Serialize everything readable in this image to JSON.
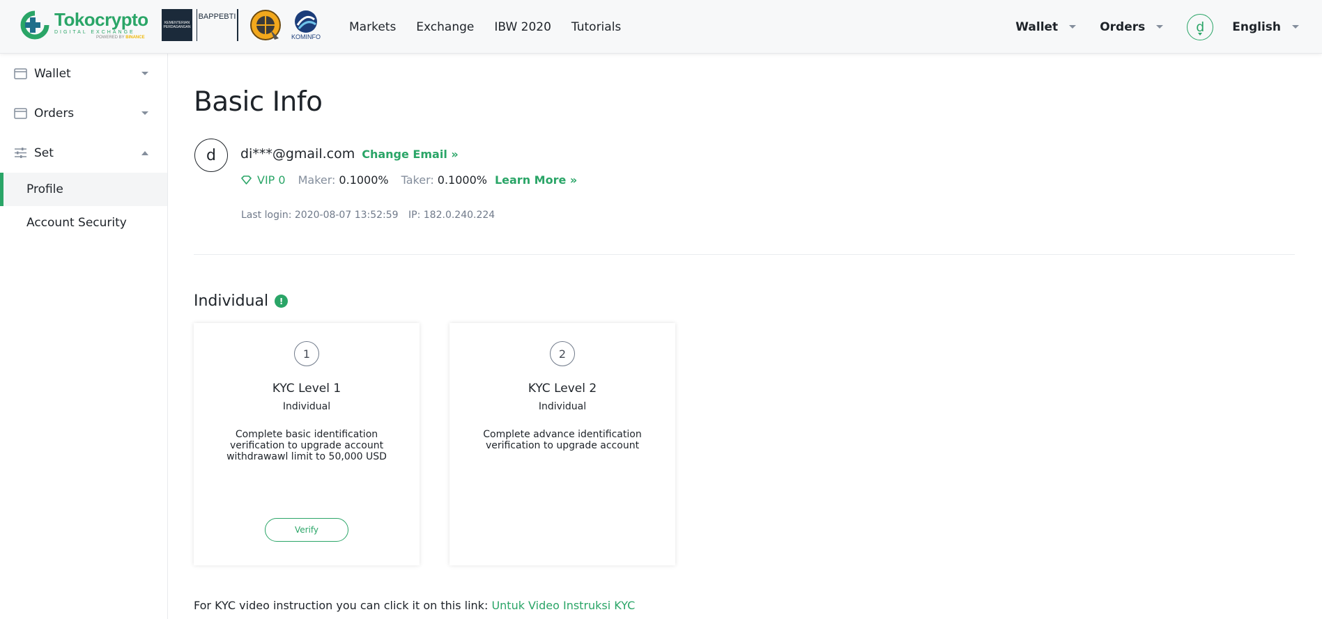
{
  "header": {
    "logo": {
      "title": "Tokocrypto",
      "subtitle": "DIGITAL EXCHANGE",
      "powered_by": "POWERED BY",
      "powered_brand": "BINANCE"
    },
    "partners": {
      "bappebti": "BAPPEBTI",
      "kemendag": "KEMENTERIAN PERDAGANGAN",
      "kominfo": "KOMINFO"
    },
    "nav": [
      "Markets",
      "Exchange",
      "IBW 2020",
      "Tutorials"
    ],
    "right": {
      "wallet": "Wallet",
      "orders": "Orders",
      "avatar_initial": "d",
      "language": "English"
    }
  },
  "sidebar": {
    "wallet": "Wallet",
    "orders": "Orders",
    "set": "Set",
    "profile": "Profile",
    "account_security": "Account Security"
  },
  "main": {
    "title": "Basic Info",
    "avatar_initial": "d",
    "email": "di***@gmail.com",
    "change_email": "Change Email »",
    "vip": "VIP 0",
    "maker_label": "Maker:",
    "maker_value": "0.1000%",
    "taker_label": "Taker:",
    "taker_value": "0.1000%",
    "learn_more": "Learn More »",
    "last_login": "Last login: 2020-08-07 13:52:59",
    "ip": "IP: 182.0.240.224",
    "section_title": "Individual",
    "kyc": [
      {
        "step": "1",
        "name": "KYC Level 1",
        "type": "Individual",
        "description": "Complete basic identification verification to upgrade account withdrawawl limit to 50,000 USD",
        "button": "Verify"
      },
      {
        "step": "2",
        "name": "KYC Level 2",
        "type": "Individual",
        "description": "Complete advance identification verification to upgrade account"
      }
    ],
    "video_text": "For KYC video instruction you can click it on this link:",
    "video_link": "Untuk Video Instruksi KYC"
  },
  "colors": {
    "accent": "#2aa567",
    "text": "#1e2329",
    "muted": "#848e9c"
  }
}
